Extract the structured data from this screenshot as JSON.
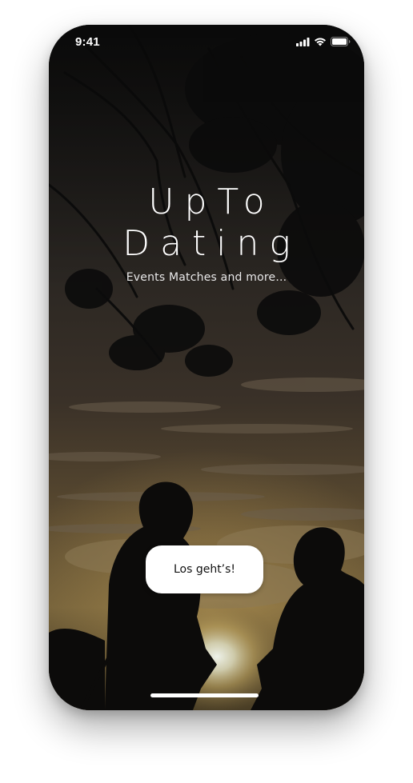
{
  "status_bar": {
    "time": "9:41",
    "icons": [
      "cellular-signal-icon",
      "wifi-icon",
      "battery-icon"
    ]
  },
  "app": {
    "title_line_1": "UpTo",
    "title_line_2": "Dating",
    "tagline": "Events Matches and more..."
  },
  "actions": {
    "start_button_label": "Los geht’s!"
  },
  "colors": {
    "text": "#ffffff",
    "button_background": "#ffffff",
    "button_text": "#111111",
    "sunset_glow": "#c7a45a"
  }
}
